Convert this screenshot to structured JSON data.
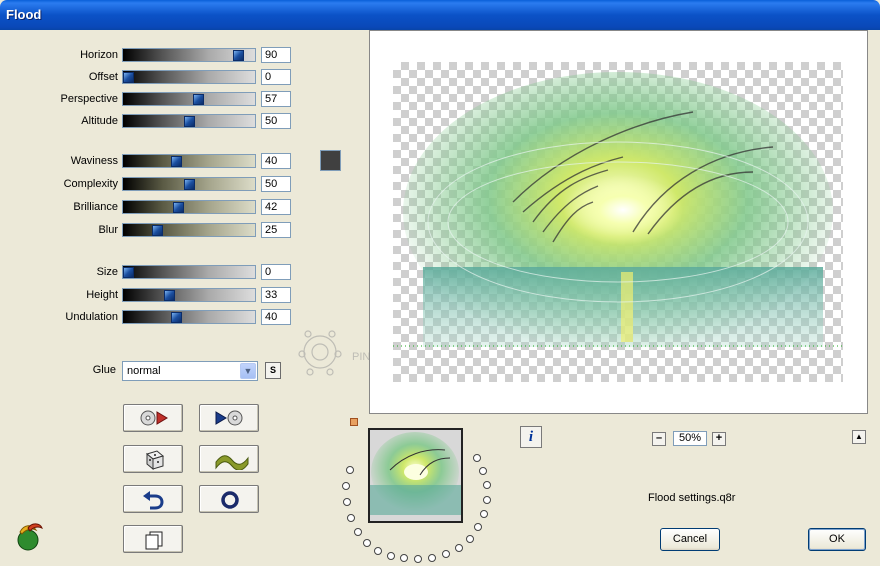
{
  "window": {
    "title": "Flood"
  },
  "sliders": [
    {
      "label": "Horizon",
      "value": "90",
      "style": "gray"
    },
    {
      "label": "Offset",
      "value": "0",
      "style": "gray"
    },
    {
      "label": "Perspective",
      "value": "57",
      "style": "gray"
    },
    {
      "label": "Altitude",
      "value": "50",
      "style": "gray"
    },
    {
      "label": "Waviness",
      "value": "40",
      "style": "olive"
    },
    {
      "label": "Complexity",
      "value": "50",
      "style": "olive"
    },
    {
      "label": "Brilliance",
      "value": "42",
      "style": "olive"
    },
    {
      "label": "Blur",
      "value": "25",
      "style": "olive"
    },
    {
      "label": "Size",
      "value": "0",
      "style": "gray"
    },
    {
      "label": "Height",
      "value": "33",
      "style": "gray"
    },
    {
      "label": "Undulation",
      "value": "40",
      "style": "gray"
    }
  ],
  "color_swatch": {
    "color": "#404040"
  },
  "glue": {
    "label": "Glue",
    "selected": "normal",
    "s_button": "S"
  },
  "toolbar": {
    "buttons": [
      {
        "name": "load-preset",
        "icon": "cd-play-icon"
      },
      {
        "name": "save-preset",
        "icon": "play-cd-icon"
      },
      {
        "name": "random",
        "icon": "dice-icon"
      },
      {
        "name": "wave",
        "icon": "wave-icon"
      },
      {
        "name": "undo",
        "icon": "undo-arrow-icon"
      },
      {
        "name": "reset",
        "icon": "circle-icon"
      },
      {
        "name": "copy",
        "icon": "copy-pages-icon"
      }
    ]
  },
  "watermark": {
    "text": "PINUCCIA"
  },
  "zoom": {
    "minus": "–",
    "value": "50%",
    "plus": "+"
  },
  "info": {
    "label": "i"
  },
  "settings_file": "Flood settings.q8r",
  "buttons": {
    "cancel": "Cancel",
    "ok": "OK"
  }
}
